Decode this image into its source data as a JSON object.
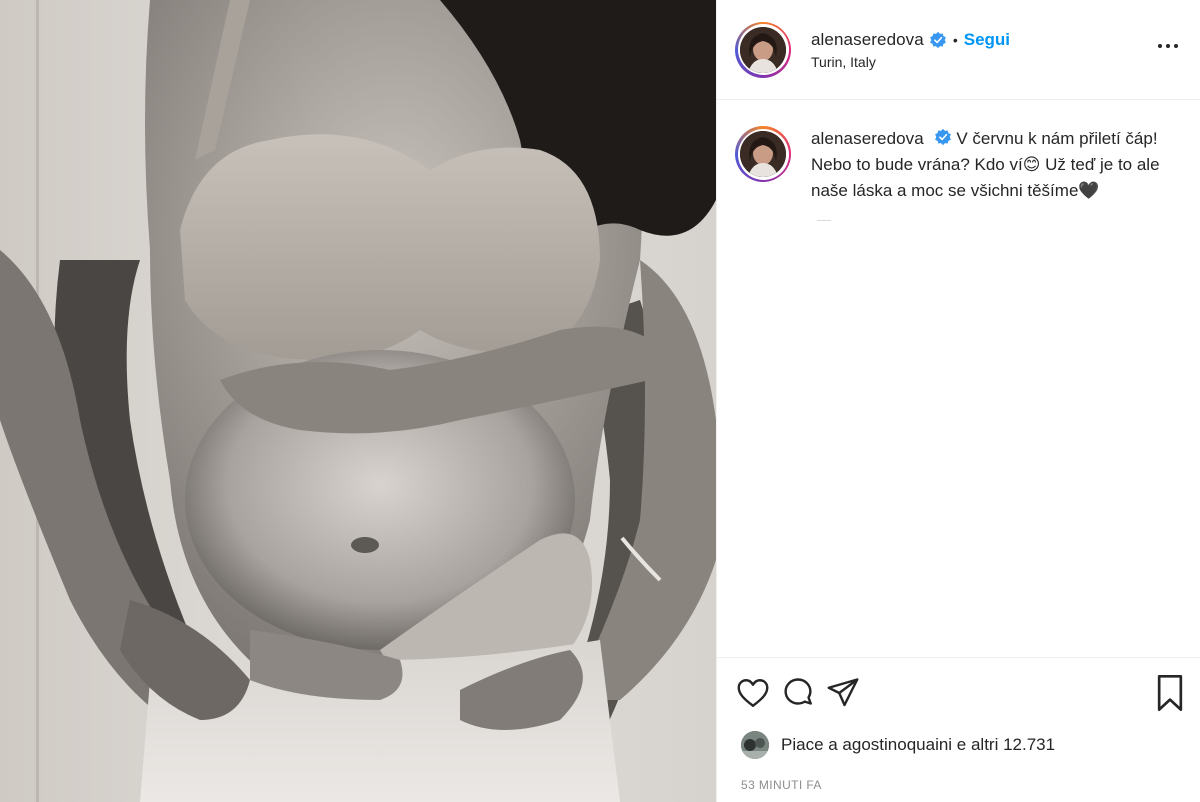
{
  "post": {
    "username": "alenaseredova",
    "follow_label": "Segui",
    "separator": "•",
    "location": "Turin, Italy",
    "caption": "V červnu k nám přiletí čáp! Nebo to bude vrána? Kdo ví😊 Už teď je to ale naše láska a moc se všichni těšíme🖤",
    "likes_text": "Piace a agostinoquaini e altri 12.731",
    "timestamp": "53 MINUTI FA",
    "photo_description": "black-and-white-photo",
    "icons": {
      "verified": "verified-badge-icon",
      "more": "more-options-icon",
      "like": "heart-icon",
      "comment": "comment-icon",
      "share": "paper-plane-icon",
      "save": "bookmark-icon"
    },
    "colors": {
      "accent": "#0095f6",
      "text": "#262626",
      "muted": "#8e8e8e",
      "border": "#efefef"
    }
  }
}
